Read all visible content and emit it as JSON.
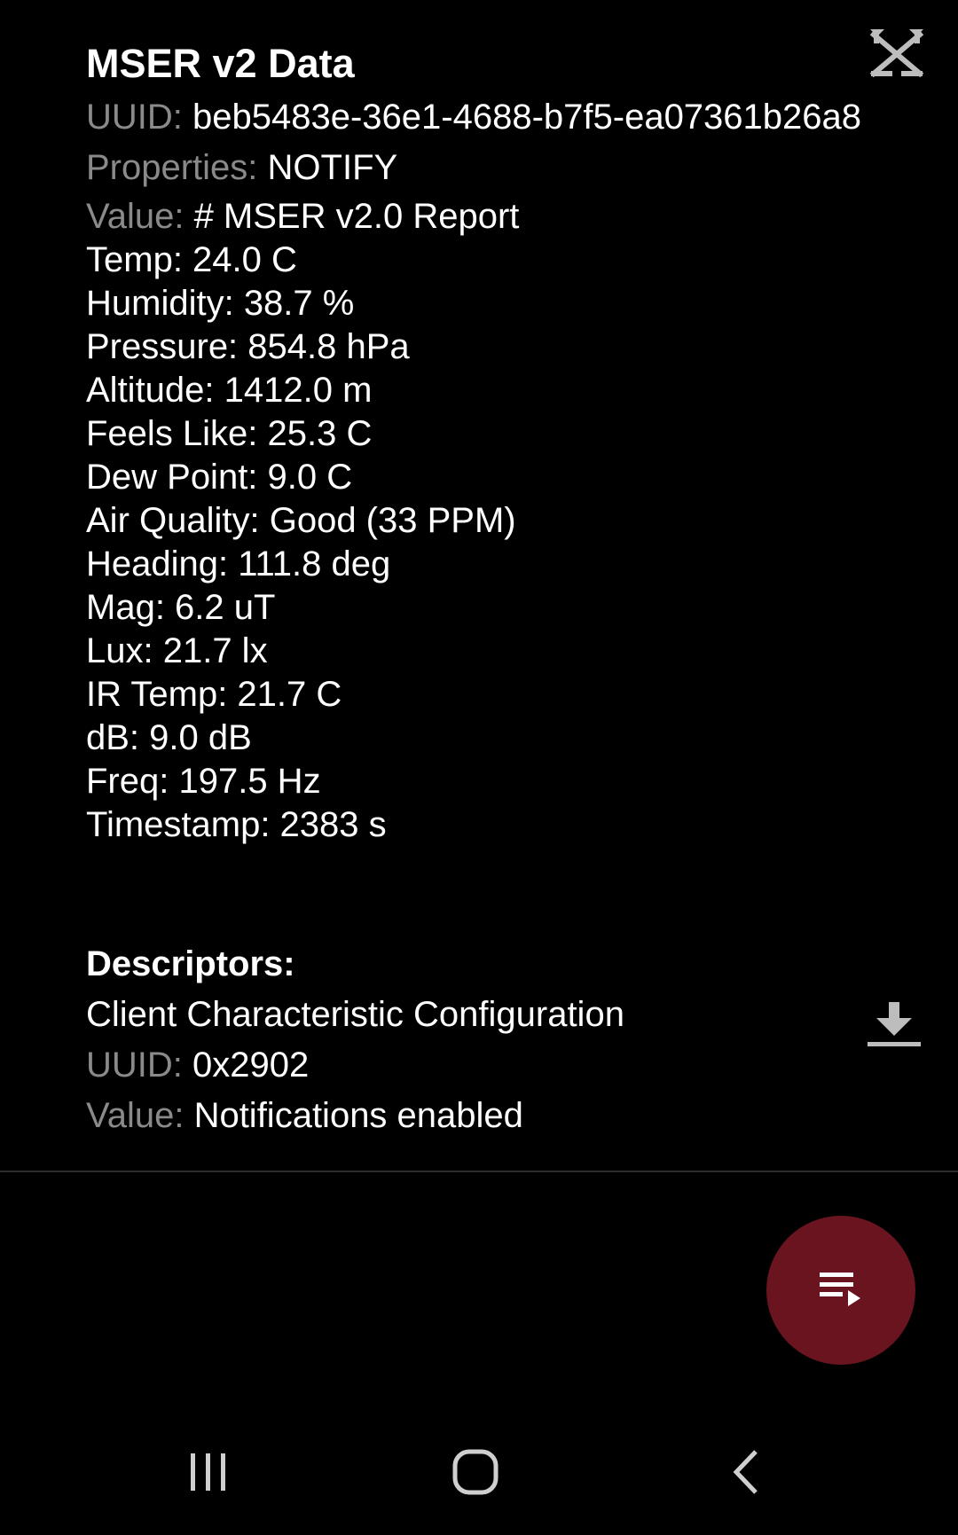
{
  "characteristic": {
    "name": "MSER v2 Data",
    "uuid_label": "UUID: ",
    "uuid": "beb5483e-36e1-4688-b7f5-ea07361b26a8",
    "properties_label": "Properties: ",
    "properties": "NOTIFY",
    "value_label": "Value: ",
    "value_lines": [
      "# MSER v2.0 Report",
      "Temp: 24.0 C",
      "Humidity: 38.7 %",
      "Pressure: 854.8 hPa",
      "Altitude: 1412.0 m",
      "Feels Like: 25.3 C",
      "Dew Point: 9.0 C",
      "Air Quality: Good (33 PPM)",
      "Heading: 111.8 deg",
      "Mag: 6.2 uT",
      "Lux: 21.7 lx",
      "IR Temp: 21.7 C",
      "dB: 9.0 dB",
      "Freq: 197.5 Hz",
      "Timestamp: 2383 s"
    ],
    "notify_icon": "notifications-disable-icon"
  },
  "descriptors": {
    "title": "Descriptors:",
    "items": [
      {
        "name": "Client Characteristic Configuration",
        "uuid_label": "UUID: ",
        "uuid": "0x2902",
        "value_label": "Value: ",
        "value": "Notifications enabled",
        "read_icon": "download-icon"
      }
    ]
  },
  "fab": {
    "icon": "playlist-play-icon"
  },
  "navigation": {
    "recents_icon": "recents-icon",
    "home_icon": "home-icon",
    "back_icon": "back-icon"
  },
  "colors": {
    "background": "#000000",
    "label_gray": "#8a8a8a",
    "fab_background": "#6a1420",
    "icon_gray": "#bdbdbd"
  }
}
